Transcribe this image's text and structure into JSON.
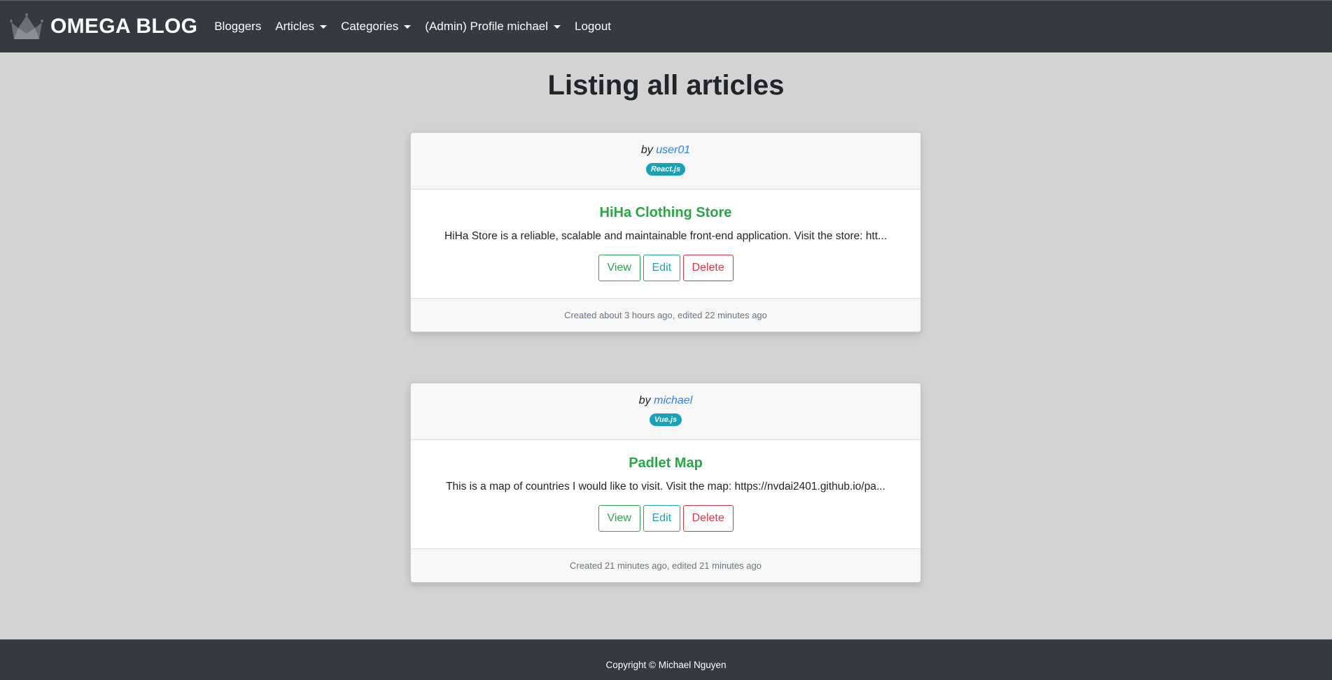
{
  "nav": {
    "brand": "OMEGA BLOG",
    "items": [
      {
        "label": "Bloggers",
        "dropdown": false
      },
      {
        "label": "Articles",
        "dropdown": true
      },
      {
        "label": "Categories",
        "dropdown": true
      },
      {
        "label": "(Admin) Profile michael",
        "dropdown": true
      },
      {
        "label": "Logout",
        "dropdown": false
      }
    ]
  },
  "page": {
    "title": "Listing all articles"
  },
  "articles": [
    {
      "by": "by",
      "author": "user01",
      "category": "React.js",
      "title": "HiHa Clothing Store",
      "excerpt": "HiHa Store is a reliable, scalable and maintainable front-end application. Visit the store: htt...",
      "view_label": "View",
      "edit_label": "Edit",
      "delete_label": "Delete",
      "meta": "Created about 3 hours ago, edited 22 minutes ago"
    },
    {
      "by": "by",
      "author": "michael",
      "category": "Vue.js",
      "title": "Padlet Map",
      "excerpt": "This is a map of countries I would like to visit. Visit the map: https://nvdai2401.github.io/pa...",
      "view_label": "View",
      "edit_label": "Edit",
      "delete_label": "Delete",
      "meta": "Created 21 minutes ago, edited 21 minutes ago"
    }
  ],
  "footer": {
    "copyright": "Copyright © Michael Nguyen"
  },
  "colors": {
    "navbar": "#343a40",
    "background": "#d3d3d3",
    "success": "#28a745",
    "info": "#17a2b8",
    "danger": "#dc3545",
    "link": "#2f80ed"
  },
  "icons": {
    "brand": "crown-logo-icon"
  }
}
